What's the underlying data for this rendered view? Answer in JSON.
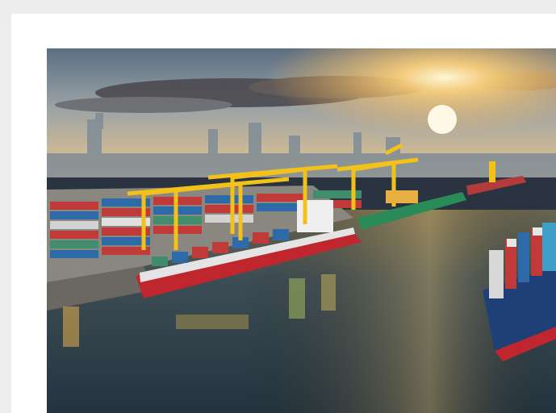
{
  "image": {
    "description": "",
    "alt": ""
  },
  "colors": {
    "page_background": "#ededed",
    "card_background": "#ffffff",
    "sky_top": "#5a6d80",
    "sunset_glow": "#ffd27a",
    "water": "#3a4a55",
    "crane": "#f2c21b",
    "hull_red": "#c0262d"
  }
}
